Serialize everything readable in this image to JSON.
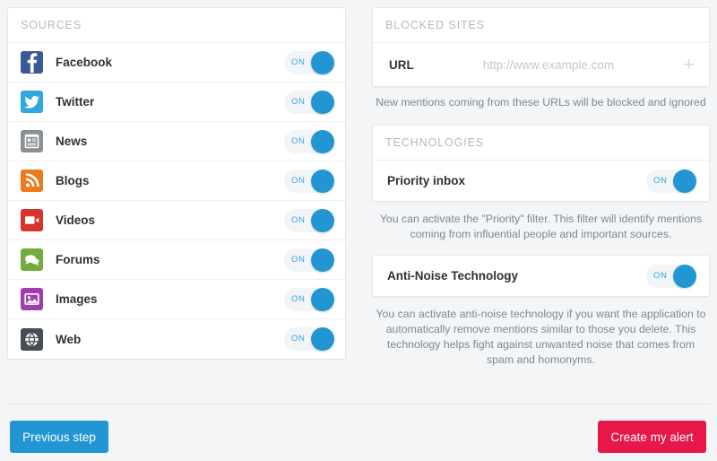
{
  "theme": {
    "page_bg": "#f3f5f7",
    "card_bg": "#ffffff",
    "accent_blue": "#2196d3",
    "accent_red": "#e8174a",
    "toggle_track": "#f2f5f7",
    "header_text": "#b3b9c0",
    "body_text": "#2d3238",
    "helper_text": "#7d8894"
  },
  "sources_panel": {
    "header": "SOURCES",
    "items": [
      {
        "label": "Facebook",
        "icon": "facebook-icon",
        "icon_bg": "#3b5998",
        "toggle": "ON"
      },
      {
        "label": "Twitter",
        "icon": "twitter-icon",
        "icon_bg": "#2fa8e0",
        "toggle": "ON"
      },
      {
        "label": "News",
        "icon": "news-icon",
        "icon_bg": "#8b9096",
        "toggle": "ON"
      },
      {
        "label": "Blogs",
        "icon": "rss-icon",
        "icon_bg": "#ec7b1e",
        "toggle": "ON"
      },
      {
        "label": "Videos",
        "icon": "video-icon",
        "icon_bg": "#d6342c",
        "toggle": "ON"
      },
      {
        "label": "Forums",
        "icon": "forum-icon",
        "icon_bg": "#74ab3f",
        "toggle": "ON"
      },
      {
        "label": "Images",
        "icon": "image-icon",
        "icon_bg": "#a33cb0",
        "toggle": "ON"
      },
      {
        "label": "Web",
        "icon": "globe-icon",
        "icon_bg": "#464d55",
        "toggle": "ON"
      }
    ]
  },
  "blocked_sites_panel": {
    "header": "BLOCKED SITES",
    "url_label": "URL",
    "url_value": "",
    "url_placeholder": "http://www.example.com",
    "add_icon": "plus-icon",
    "helper": "New mentions coming from these URLs will be blocked and ignored"
  },
  "technologies_panel": {
    "header": "TECHNOLOGIES",
    "priority_inbox": {
      "label": "Priority inbox",
      "toggle": "ON",
      "helper": "You can activate the \"Priority\" filter. This filter will identify mentions coming from influential people and important sources."
    },
    "anti_noise": {
      "label": "Anti-Noise Technology",
      "toggle": "ON",
      "helper": "You can activate anti-noise technology if you want the application to automatically remove mentions similar to those you delete. This technology helps fight against unwanted noise that comes from spam and homonyms."
    }
  },
  "footer": {
    "previous_label": "Previous step",
    "create_label": "Create my alert"
  }
}
